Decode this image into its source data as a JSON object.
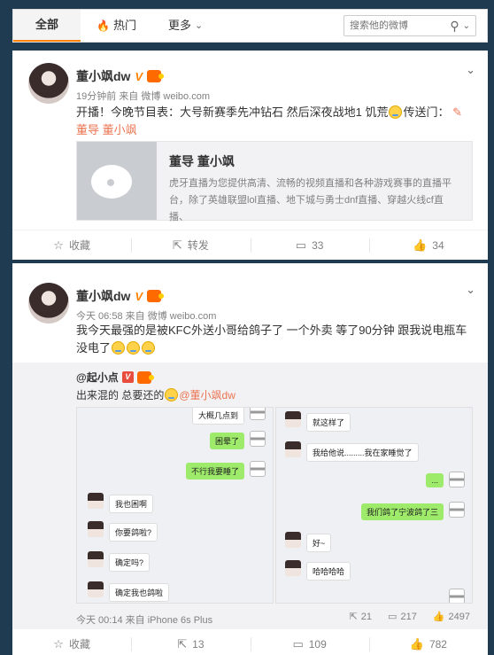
{
  "nav": {
    "tabs": [
      "全部",
      "热门",
      "更多"
    ],
    "search_placeholder": "搜索他的微博"
  },
  "post1": {
    "author": "董小飒dw",
    "verified_mark": "V",
    "time": "19分钟前",
    "source_prefix": "来自",
    "source": "微博 weibo.com",
    "text_a": "开播！今晚节目表：大号新赛季先冲钻石 然后深夜战地1 饥荒",
    "text_b": "传送门：",
    "link": "董导 董小飒",
    "share": {
      "title": "董导 董小飒",
      "desc": "虎牙直播为您提供高清、流畅的视频直播和各种游戏赛事的直播平台，除了英雄联盟lol直播、地下城与勇士dnf直播、穿越火线cf直播、"
    },
    "actions": {
      "fav": "收藏",
      "repost": "转发",
      "comment": "33",
      "like": "34"
    }
  },
  "post2": {
    "author": "董小飒dw",
    "verified_mark": "V",
    "time": "今天 06:58",
    "source_prefix": "来自",
    "source": "微博 weibo.com",
    "text": "我今天最强的是被KFC外送小哥给鸽子了 一个外卖 等了90分钟 跟我说电瓶车没电了",
    "repost": {
      "author": "@起小点",
      "verified_mark": "V",
      "text": "出来混的 总要还的",
      "mention": "@董小飒dw",
      "chat_left": {
        "right_bubbles": [
          "大概几点到",
          "困晕了",
          "不行我要睡了"
        ],
        "left_bubbles": [
          "我也困啊",
          "你要鸽啦?",
          "确定吗?",
          "确定我也鸽啦"
        ]
      },
      "chat_right": {
        "left_bubbles": [
          "就这样了",
          "我给他说.........我在家睡觉了",
          "好~",
          "哈哈哈哈"
        ],
        "right_bubbles": [
          "...",
          "我们鸽了宁波鸽了三"
        ]
      },
      "time": "今天 00:14",
      "source_prefix": "来自",
      "source": "iPhone 6s Plus",
      "reposts": "21",
      "comments": "217",
      "likes": "2497"
    },
    "actions": {
      "fav": "收藏",
      "repost": "13",
      "comment": "109",
      "like": "782"
    }
  }
}
